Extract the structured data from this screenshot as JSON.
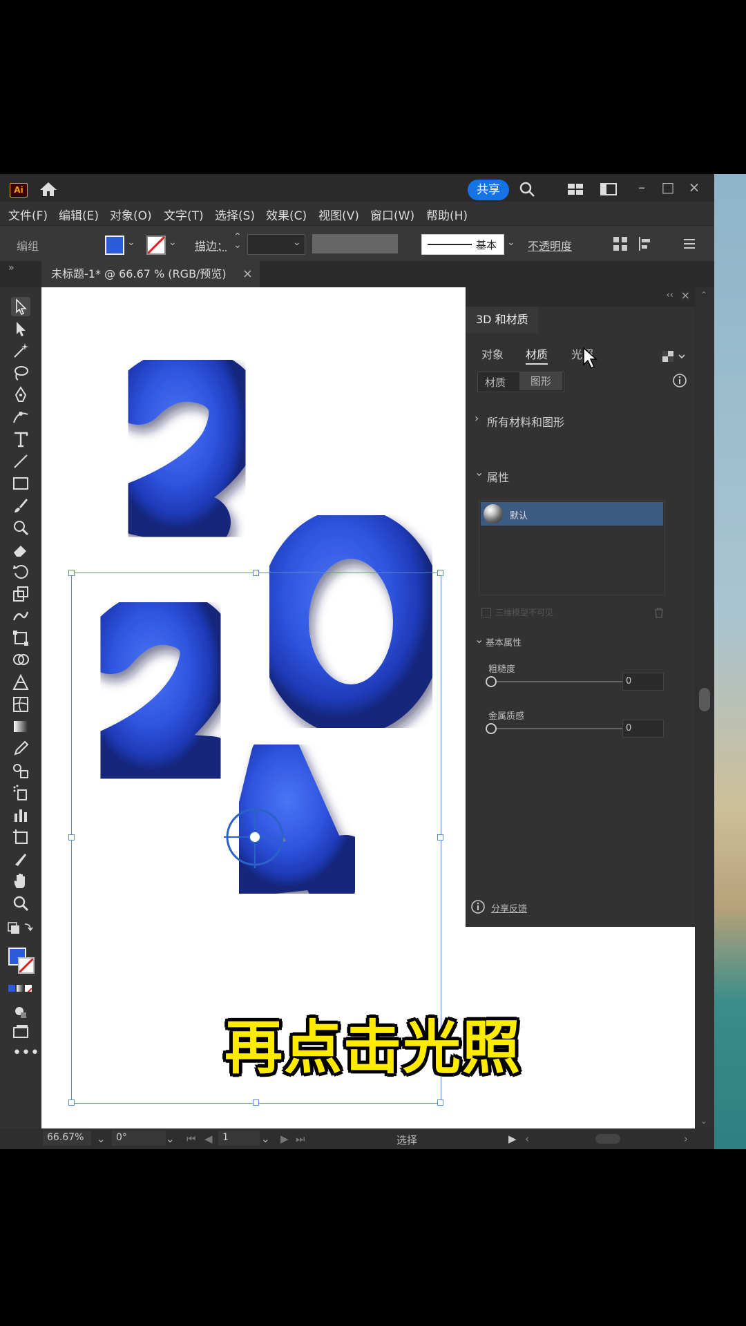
{
  "app": {
    "logo_text": "Ai",
    "share_label": "共享",
    "document_tab": "未标题-1* @ 66.67 % (RGB/预览)",
    "tab_close": "×"
  },
  "menu": [
    "文件(F)",
    "编辑(E)",
    "对象(O)",
    "文字(T)",
    "选择(S)",
    "效果(C)",
    "视图(V)",
    "窗口(W)",
    "帮助(H)"
  ],
  "control_bar": {
    "selection_label": "编组",
    "stroke_label": "描边：",
    "stroke_style": "基本",
    "opacity_label": "不透明度"
  },
  "panel": {
    "title": "3D 和材质",
    "tabs": [
      "对象",
      "材质",
      "光照"
    ],
    "active_tab": "材质",
    "segments": [
      "材质",
      "图形"
    ],
    "all_materials": "所有材料和图形",
    "properties_header": "属性",
    "material_name": "默认",
    "invisible_label": "三维模型不可见",
    "basic_props_header": "基本属性",
    "roughness_label": "粗糙度",
    "roughness_value": "0",
    "metallic_label": "金属质感",
    "metallic_value": "0",
    "feedback": "分享反馈"
  },
  "artwork": {
    "digits": [
      "2",
      "0",
      "2",
      "4"
    ],
    "color": "#2f55e0"
  },
  "status_bar": {
    "zoom": "66.67%",
    "rotation": "0°",
    "page": "1",
    "tool": "选择"
  },
  "caption": "再点击光照",
  "colors": {
    "fill_swatch": "#2c5cdc",
    "accent": "#1473e6",
    "caption": "#ffeb00"
  }
}
